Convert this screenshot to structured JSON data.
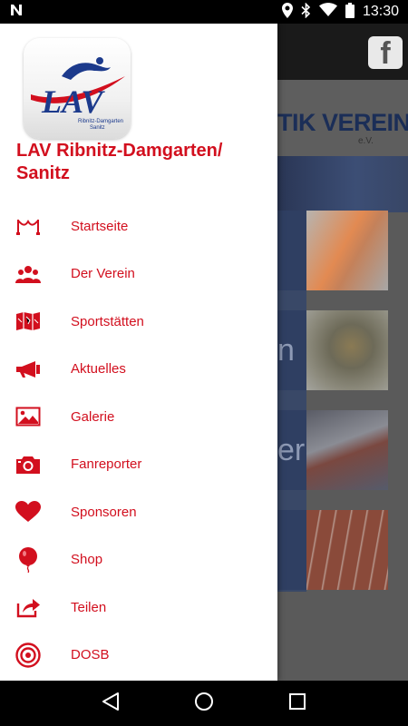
{
  "status_bar": {
    "time": "13:30",
    "icons": [
      "n-notification-icon",
      "location-icon",
      "bluetooth-icon",
      "wifi-icon",
      "battery-icon"
    ]
  },
  "background": {
    "facebook_label": "f",
    "banner_title": "TIK VEREIN",
    "banner_sub": "e.V.",
    "tile_ghost_texts": [
      "",
      "n",
      "er",
      ""
    ]
  },
  "drawer": {
    "logo_text": "LAV",
    "logo_subtext_1": "Ribnitz-Damgarten",
    "logo_subtext_2": "Sanitz",
    "club_name": "LAV Ribnitz-Damgarten/ Sanitz",
    "items": [
      {
        "label": "Startseite",
        "icon": "finish-line-icon"
      },
      {
        "label": "Der Verein",
        "icon": "group-icon"
      },
      {
        "label": "Sportstätten",
        "icon": "map-icon"
      },
      {
        "label": "Aktuelles",
        "icon": "megaphone-icon"
      },
      {
        "label": "Galerie",
        "icon": "image-icon"
      },
      {
        "label": "Fanreporter",
        "icon": "camera-icon"
      },
      {
        "label": "Sponsoren",
        "icon": "heart-icon"
      },
      {
        "label": "Shop",
        "icon": "balloon-icon"
      },
      {
        "label": "Teilen",
        "icon": "share-icon"
      },
      {
        "label": "DOSB",
        "icon": "target-icon"
      }
    ]
  },
  "colors": {
    "accent": "#d20f1e",
    "logo_blue": "#1c3a8c"
  }
}
